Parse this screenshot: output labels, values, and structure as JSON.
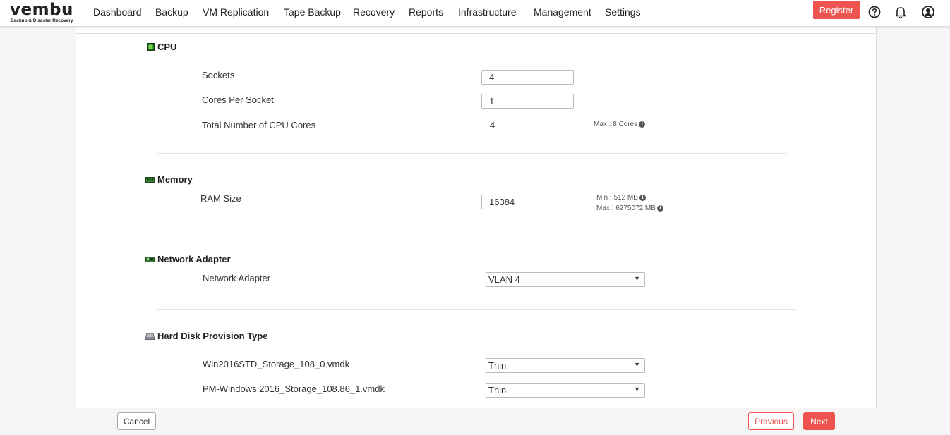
{
  "brand": {
    "name": "vembu",
    "tagline": "Backup & Disaster Recovery"
  },
  "nav": {
    "items": [
      "Dashboard",
      "Backup",
      "VM Replication",
      "Tape Backup",
      "Recovery",
      "Reports",
      "Infrastructure",
      "Management",
      "Settings"
    ],
    "register_label": "Register",
    "icons": [
      "help-icon",
      "bell-icon",
      "user-icon"
    ]
  },
  "cpu": {
    "title": "CPU",
    "sockets_label": "Sockets",
    "sockets_value": "4",
    "cores_label": "Cores Per Socket",
    "cores_value": "1",
    "total_label": "Total Number of CPU Cores",
    "total_value": "4",
    "max_hint": "Max : 8 Cores"
  },
  "memory": {
    "title": "Memory",
    "ram_label": "RAM Size",
    "ram_value": "16384",
    "min_hint": "Min : 512 MB",
    "max_hint": "Max : 6275072 MB"
  },
  "network": {
    "title": "Network Adapter",
    "adapter_label": "Network Adapter",
    "adapter_value": "VLAN 4"
  },
  "disk": {
    "title": "Hard Disk Provision Type",
    "disks": [
      {
        "name": "Win2016STD_Storage_108_0.vmdk",
        "type": "Thin"
      },
      {
        "name": "PM-Windows 2016_Storage_108.86_1.vmdk",
        "type": "Thin"
      }
    ]
  },
  "footer": {
    "cancel_label": "Cancel",
    "previous_label": "Previous",
    "next_label": "Next"
  },
  "colors": {
    "accent": "#ee5350"
  }
}
